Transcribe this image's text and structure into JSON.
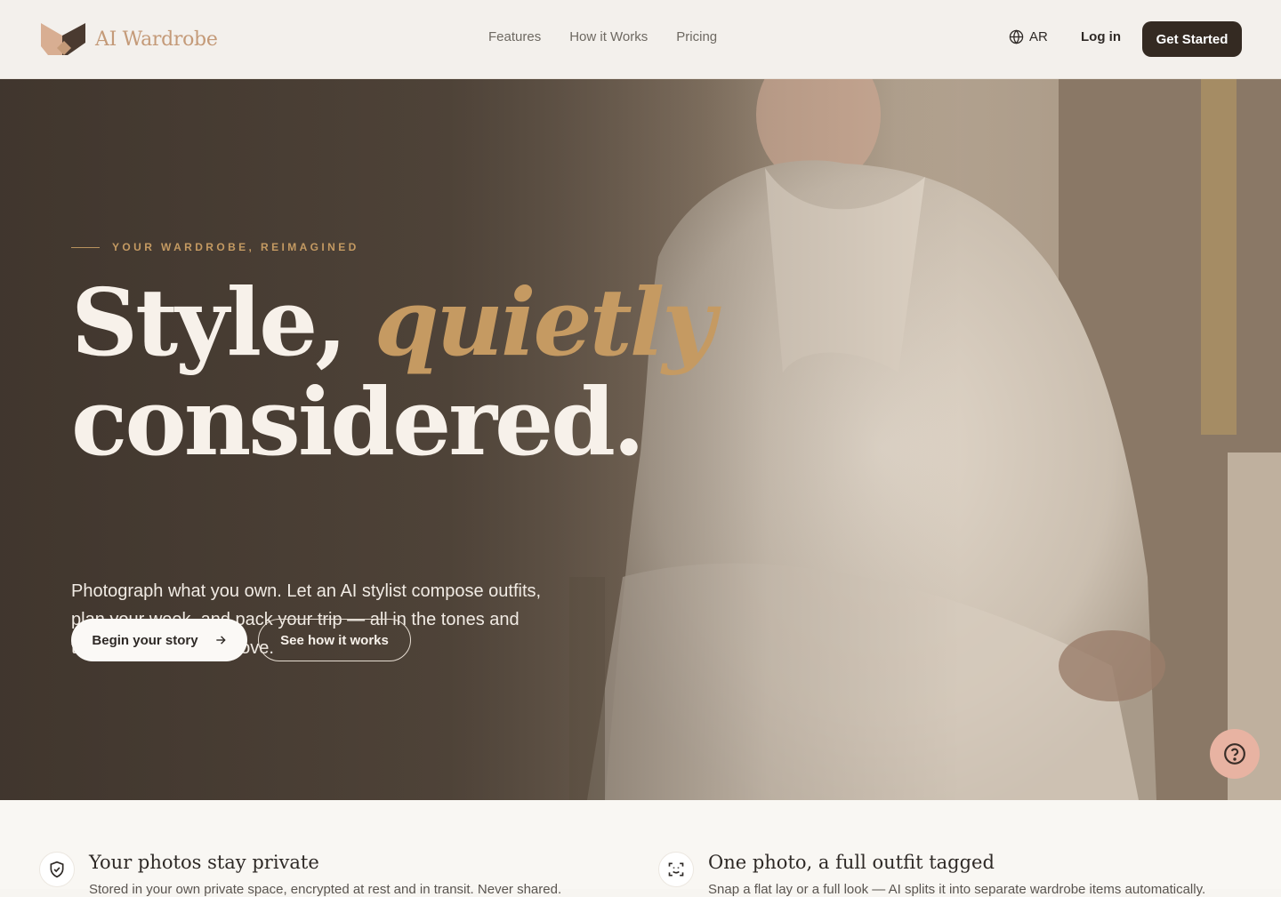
{
  "header": {
    "brand": "AI Wardrobe",
    "nav": [
      "Features",
      "How it Works",
      "Pricing"
    ],
    "language": "AR",
    "login": "Log in",
    "cta": "Get Started"
  },
  "hero": {
    "eyebrow": "YOUR WARDROBE, REIMAGINED",
    "headline_part1": "Style,",
    "headline_accent": "quietly",
    "headline_part2": "considered.",
    "subtitle": "Photograph what you own. Let an AI stylist compose outfits, plan your week, and pack your trip — all in the tones and textures you already love.",
    "primary_button": "Begin your story",
    "secondary_button": "See how it works"
  },
  "features": [
    {
      "icon": "shield-check-icon",
      "title": "Your photos stay private",
      "description": "Stored in your own private space, encrypted at rest and in transit. Never shared."
    },
    {
      "icon": "scan-icon",
      "title": "One photo, a full outfit tagged",
      "description": "Snap a flat lay or a full look — AI splits it into separate wardrobe items automatically."
    }
  ],
  "colors": {
    "brand": "#c49a78",
    "accent_gold": "#c59a62",
    "dark": "#342a22",
    "help_button": "#e8b3a2"
  }
}
